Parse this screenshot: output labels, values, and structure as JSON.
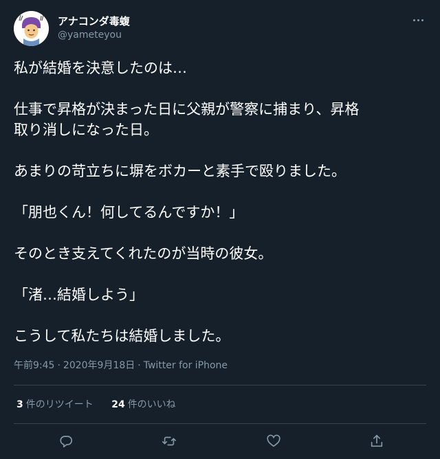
{
  "author": {
    "display_name": "アナコンダ毒蝮",
    "handle": "@yameteyou"
  },
  "tweet": {
    "paragraphs": [
      [
        "私が結婚を決意したのは…"
      ],
      [
        "仕事で昇格が決まった日に父親が警察に捕まり、昇格",
        "取り消しになった日。"
      ],
      [
        "あまりの苛立ちに塀をボカーと素手で殴りました。"
      ],
      [
        "「朋也くん！何してるんですか！」"
      ],
      [
        "そのとき支えてくれたのが当時の彼女。"
      ],
      [
        "「渚…結婚しよう」"
      ],
      [
        "こうして私たちは結婚しました。"
      ]
    ]
  },
  "meta": {
    "time": "午前9:45",
    "separator": "·",
    "date": "2020年9月18日",
    "source": "Twitter for iPhone"
  },
  "stats": {
    "retweets_count": "3",
    "retweets_label": "件のリツイート",
    "likes_count": "24",
    "likes_label": "件のいいね"
  },
  "icons": {
    "more": "more-horizontal-icon",
    "reply": "reply-icon",
    "retweet": "retweet-icon",
    "like": "heart-icon",
    "share": "share-icon"
  },
  "colors": {
    "background": "#15202b",
    "text": "#ffffff",
    "secondary": "#8899a6",
    "divider": "#38444d"
  }
}
